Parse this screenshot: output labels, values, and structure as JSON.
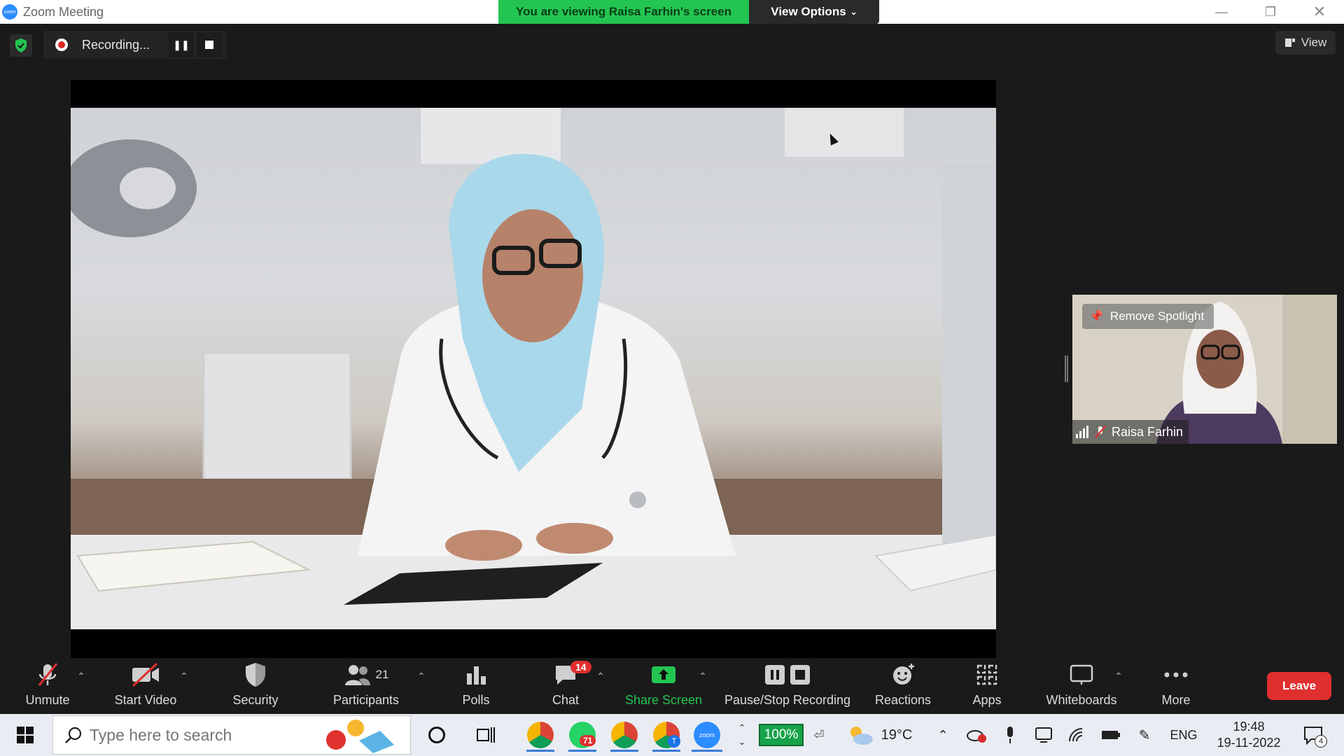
{
  "titlebar": {
    "app_title": "Zoom Meeting",
    "app_icon_text": "zoom",
    "banner_text": "You are viewing Raisa Farhin's screen",
    "view_options_label": "View Options",
    "icons": [
      "zoom-logo-icon",
      "minimize-icon",
      "restore-icon",
      "close-icon"
    ]
  },
  "overlay": {
    "recording_label": "Recording...",
    "view_label": "View",
    "icons": [
      "encryption-shield-icon",
      "record-dot-icon",
      "pause-icon",
      "stop-icon",
      "view-layout-icon"
    ]
  },
  "participant": {
    "name": "Raisa Farhin",
    "spotlight_label": "Remove Spotlight",
    "icons": [
      "pin-icon",
      "signal-strength-icon",
      "mic-muted-icon"
    ]
  },
  "toolbar": {
    "unmute_label": "Unmute",
    "start_video_label": "Start Video",
    "security_label": "Security",
    "participants_label": "Participants",
    "participants_count": "21",
    "polls_label": "Polls",
    "chat_label": "Chat",
    "chat_badge": "14",
    "share_screen_label": "Share Screen",
    "recording_label": "Pause/Stop Recording",
    "reactions_label": "Reactions",
    "apps_label": "Apps",
    "whiteboards_label": "Whiteboards",
    "more_label": "More",
    "leave_label": "Leave",
    "accent_green": "#23c552",
    "leave_red": "#e02f2f"
  },
  "taskbar": {
    "search_placeholder": "Type here to search",
    "whatsapp_badge": "71",
    "battery_label": "100%",
    "temperature": "19°C",
    "language": "ENG",
    "time": "19:48",
    "date": "19-11-2022",
    "notification_count": "4",
    "chrome_profile_t": "T",
    "zoom_app_text": "zoom"
  }
}
